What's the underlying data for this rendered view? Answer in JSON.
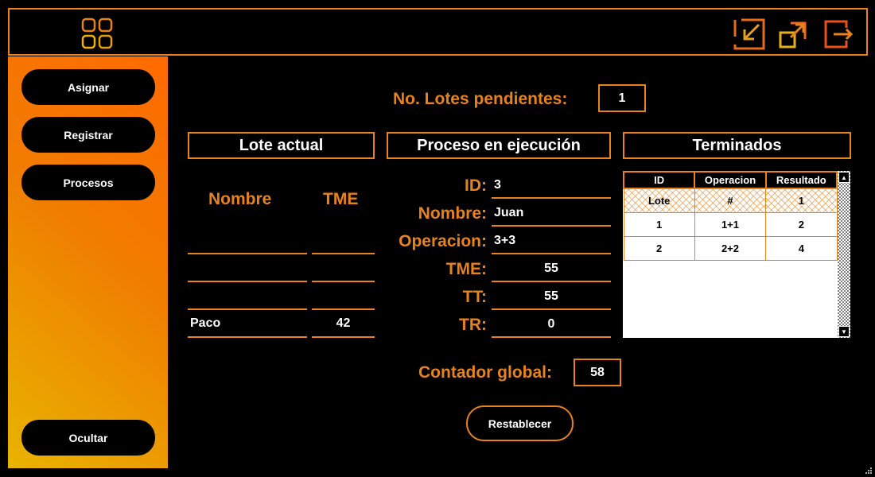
{
  "titlebar": {
    "icons": [
      "apps-grid-icon",
      "minimize-icon",
      "maximize-icon",
      "exit-icon"
    ]
  },
  "sidebar": {
    "items": [
      {
        "label": "Asignar"
      },
      {
        "label": "Registrar"
      },
      {
        "label": "Procesos"
      }
    ],
    "bottom_label": "Ocultar"
  },
  "pending": {
    "label": "No. Lotes pendientes:",
    "value": "1"
  },
  "lote_actual": {
    "title": "Lote actual",
    "col_nombre": "Nombre",
    "col_tme": "TME",
    "rows": [
      {
        "nombre": "",
        "tme": ""
      },
      {
        "nombre": "",
        "tme": ""
      },
      {
        "nombre": "",
        "tme": ""
      },
      {
        "nombre": "Paco",
        "tme": "42"
      }
    ]
  },
  "proceso": {
    "title": "Proceso en ejecución",
    "fields": [
      {
        "label": "ID:",
        "value": "3"
      },
      {
        "label": "Nombre:",
        "value": "Juan"
      },
      {
        "label": "Operacion:",
        "value": "3+3"
      },
      {
        "label": "TME:",
        "value": "55"
      },
      {
        "label": "TT:",
        "value": "55"
      },
      {
        "label": "TR:",
        "value": "0"
      }
    ]
  },
  "terminados": {
    "title": "Terminados",
    "columns": [
      "ID",
      "Operacion",
      "Resultado"
    ],
    "rows": [
      [
        "Lote",
        "#",
        "1"
      ],
      [
        "1",
        "1+1",
        "2"
      ],
      [
        "2",
        "2+2",
        "4"
      ]
    ]
  },
  "contador": {
    "label": "Contador global:",
    "value": "58"
  },
  "reset_label": "Restablecer",
  "colors": {
    "accent": "#e8821c",
    "background": "#000000",
    "sidebar_start": "#e8b400",
    "sidebar_end": "#ff6a00"
  }
}
